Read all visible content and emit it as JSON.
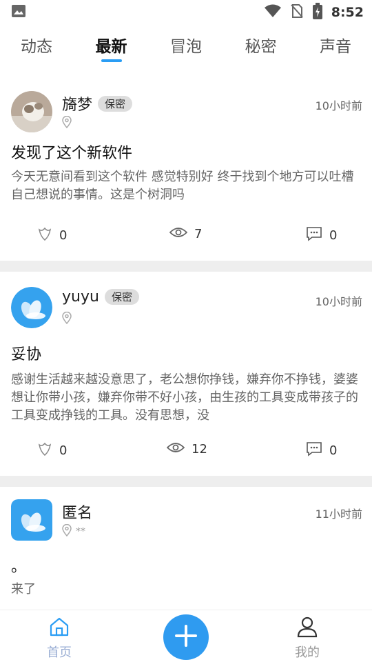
{
  "status_bar": {
    "time": "8:52",
    "icons": [
      "image-icon",
      "wifi-icon",
      "no-sim-icon",
      "battery-charging-icon"
    ]
  },
  "tabs": [
    {
      "label": "动态",
      "active": false
    },
    {
      "label": "最新",
      "active": true
    },
    {
      "label": "冒泡",
      "active": false
    },
    {
      "label": "秘密",
      "active": false
    },
    {
      "label": "声音",
      "active": false
    }
  ],
  "posts": [
    {
      "username": "旖梦",
      "badge": "保密",
      "location": "",
      "time_ago": "10小时前",
      "title": "发现了这个新软件",
      "content": "今天无意间看到这个软件 感觉特别好 终于找到个地方可以吐槽自己想说的事情。这是个树洞吗",
      "likes": "0",
      "views": "7",
      "comments": "0",
      "avatar": "cat-photo"
    },
    {
      "username": "yuyu",
      "badge": "保密",
      "location": "",
      "time_ago": "10小时前",
      "title": "妥协",
      "content": "感谢生活越来越没意思了，老公想你挣钱，嫌弃你不挣钱，婆婆想让你带小孩，嫌弃你带不好小孩，由生孩的工具变成带孩子的工具变成挣钱的工具。没有思想，没",
      "likes": "0",
      "views": "12",
      "comments": "0",
      "avatar": "app-logo"
    },
    {
      "username": "匿名",
      "badge": "",
      "location": "**",
      "time_ago": "11小时前",
      "title": "。",
      "content": "来了",
      "avatar": "app-logo-square"
    }
  ],
  "bottom_nav": {
    "home_label": "首页",
    "mine_label": "我的",
    "add_icon": "plus-icon"
  },
  "colors": {
    "accent": "#2a9df4",
    "divider": "#eeeeee"
  }
}
